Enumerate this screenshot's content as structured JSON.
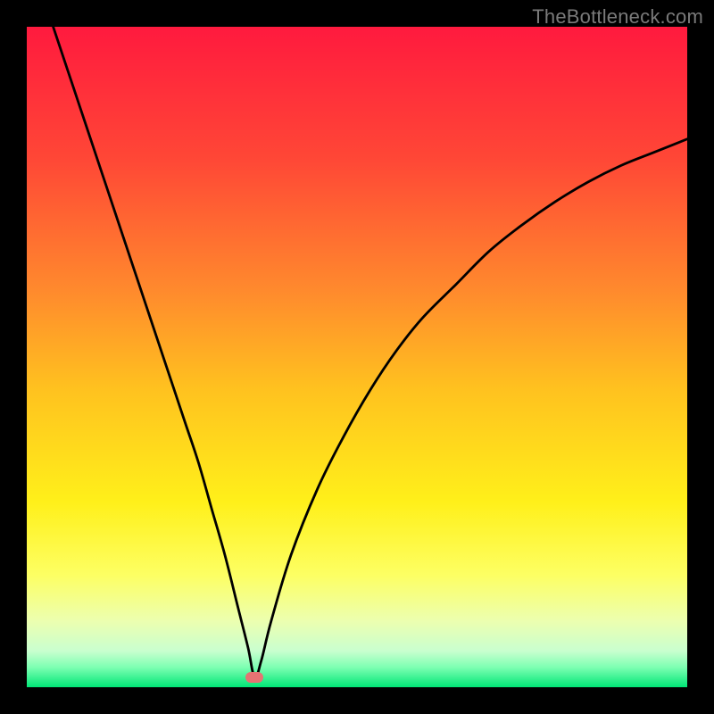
{
  "attribution": "TheBottleneck.com",
  "chart_data": {
    "type": "line",
    "title": "",
    "xlabel": "",
    "ylabel": "",
    "xlim": [
      0,
      100
    ],
    "ylim": [
      0,
      100
    ],
    "grid": false,
    "legend": false,
    "gradient_stops": [
      {
        "offset": 0,
        "color": "#ff1a3e"
      },
      {
        "offset": 0.2,
        "color": "#ff4736"
      },
      {
        "offset": 0.4,
        "color": "#ff8a2d"
      },
      {
        "offset": 0.55,
        "color": "#ffc21f"
      },
      {
        "offset": 0.72,
        "color": "#fff01a"
      },
      {
        "offset": 0.83,
        "color": "#fdff63"
      },
      {
        "offset": 0.9,
        "color": "#ecffb0"
      },
      {
        "offset": 0.945,
        "color": "#c9ffcf"
      },
      {
        "offset": 0.97,
        "color": "#7dffb2"
      },
      {
        "offset": 1.0,
        "color": "#00e676"
      }
    ],
    "series": [
      {
        "name": "bottleneck-curve",
        "color": "#000000",
        "x": [
          4,
          6,
          8,
          10,
          12,
          14,
          16,
          18,
          20,
          22,
          24,
          26,
          28,
          30,
          32,
          33.5,
          34.5,
          35.5,
          37,
          40,
          44,
          48,
          52,
          56,
          60,
          65,
          70,
          75,
          80,
          85,
          90,
          95,
          100
        ],
        "y": [
          100,
          94,
          88,
          82,
          76,
          70,
          64,
          58,
          52,
          46,
          40,
          34,
          27,
          20,
          12,
          6,
          1.5,
          4,
          10,
          20,
          30,
          38,
          45,
          51,
          56,
          61,
          66,
          70,
          73.5,
          76.5,
          79,
          81,
          83
        ]
      }
    ],
    "marker": {
      "x": 34.5,
      "y": 1.5,
      "color": "#e57373"
    }
  }
}
